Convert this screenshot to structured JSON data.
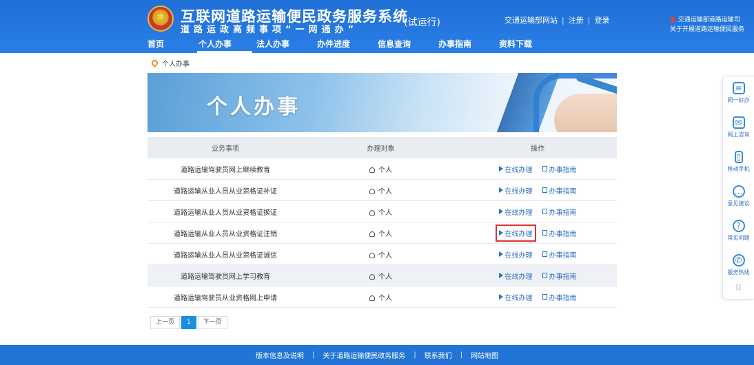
{
  "header": {
    "title": "互联网道路运输便民政务服务系统",
    "subtitle": "道路运政高频事项“一网通办”",
    "trial": "(试运行)",
    "links": [
      "交通运输部网站",
      "注册",
      "登录"
    ],
    "notice_lines": [
      "交通运输部道路运输司",
      "关于开展道路运输便民服务"
    ]
  },
  "nav": {
    "items": [
      "首页",
      "个人办事",
      "法人办事",
      "办件进度",
      "信息查询",
      "办事指南",
      "资料下载"
    ],
    "active_index": 1
  },
  "breadcrumb": {
    "label": "个人办事"
  },
  "banner": {
    "title": "个人办事"
  },
  "table": {
    "headers": [
      "业务事项",
      "办理对象",
      "操作"
    ],
    "rows": [
      {
        "item": "道路运输驾驶员网上继续教育",
        "target": "个人"
      },
      {
        "item": "道路运输从业人员从业资格证补证",
        "target": "个人"
      },
      {
        "item": "道路运输从业人员从业资格证换证",
        "target": "个人"
      },
      {
        "item": "道路运输从业人员从业资格证注销",
        "target": "个人"
      },
      {
        "item": "道路运输从业人员从业资格证诚信",
        "target": "个人"
      },
      {
        "item": "道路运输驾驶员网上学习教育",
        "target": "个人"
      },
      {
        "item": "道路运输驾驶员从业资格网上申请",
        "target": "个人"
      }
    ],
    "op_online": "在线办理",
    "op_guide": "办事指南",
    "highlight_row": 3
  },
  "pager": {
    "prev": "上一页",
    "current": "1",
    "next": "下一页"
  },
  "side": {
    "items": [
      {
        "label": "网一好办",
        "icon": "doc-icon"
      },
      {
        "label": "网上咨询",
        "icon": "mail-icon"
      },
      {
        "label": "移动手机",
        "icon": "phone-icon"
      },
      {
        "label": "意见建议",
        "icon": "chat-icon"
      },
      {
        "label": "常见问题",
        "icon": "question-icon"
      },
      {
        "label": "服务热线",
        "icon": "call-icon"
      }
    ],
    "collapse": "[]"
  },
  "footer": {
    "links": [
      "版本信息及说明",
      "关于道路运输便民政务服务",
      "联系我们",
      "网站地图"
    ]
  },
  "colors": {
    "header": "#2a7fe6",
    "footer": "#2375d5",
    "link": "#2f6fc6",
    "highlight": "#e0312e"
  }
}
